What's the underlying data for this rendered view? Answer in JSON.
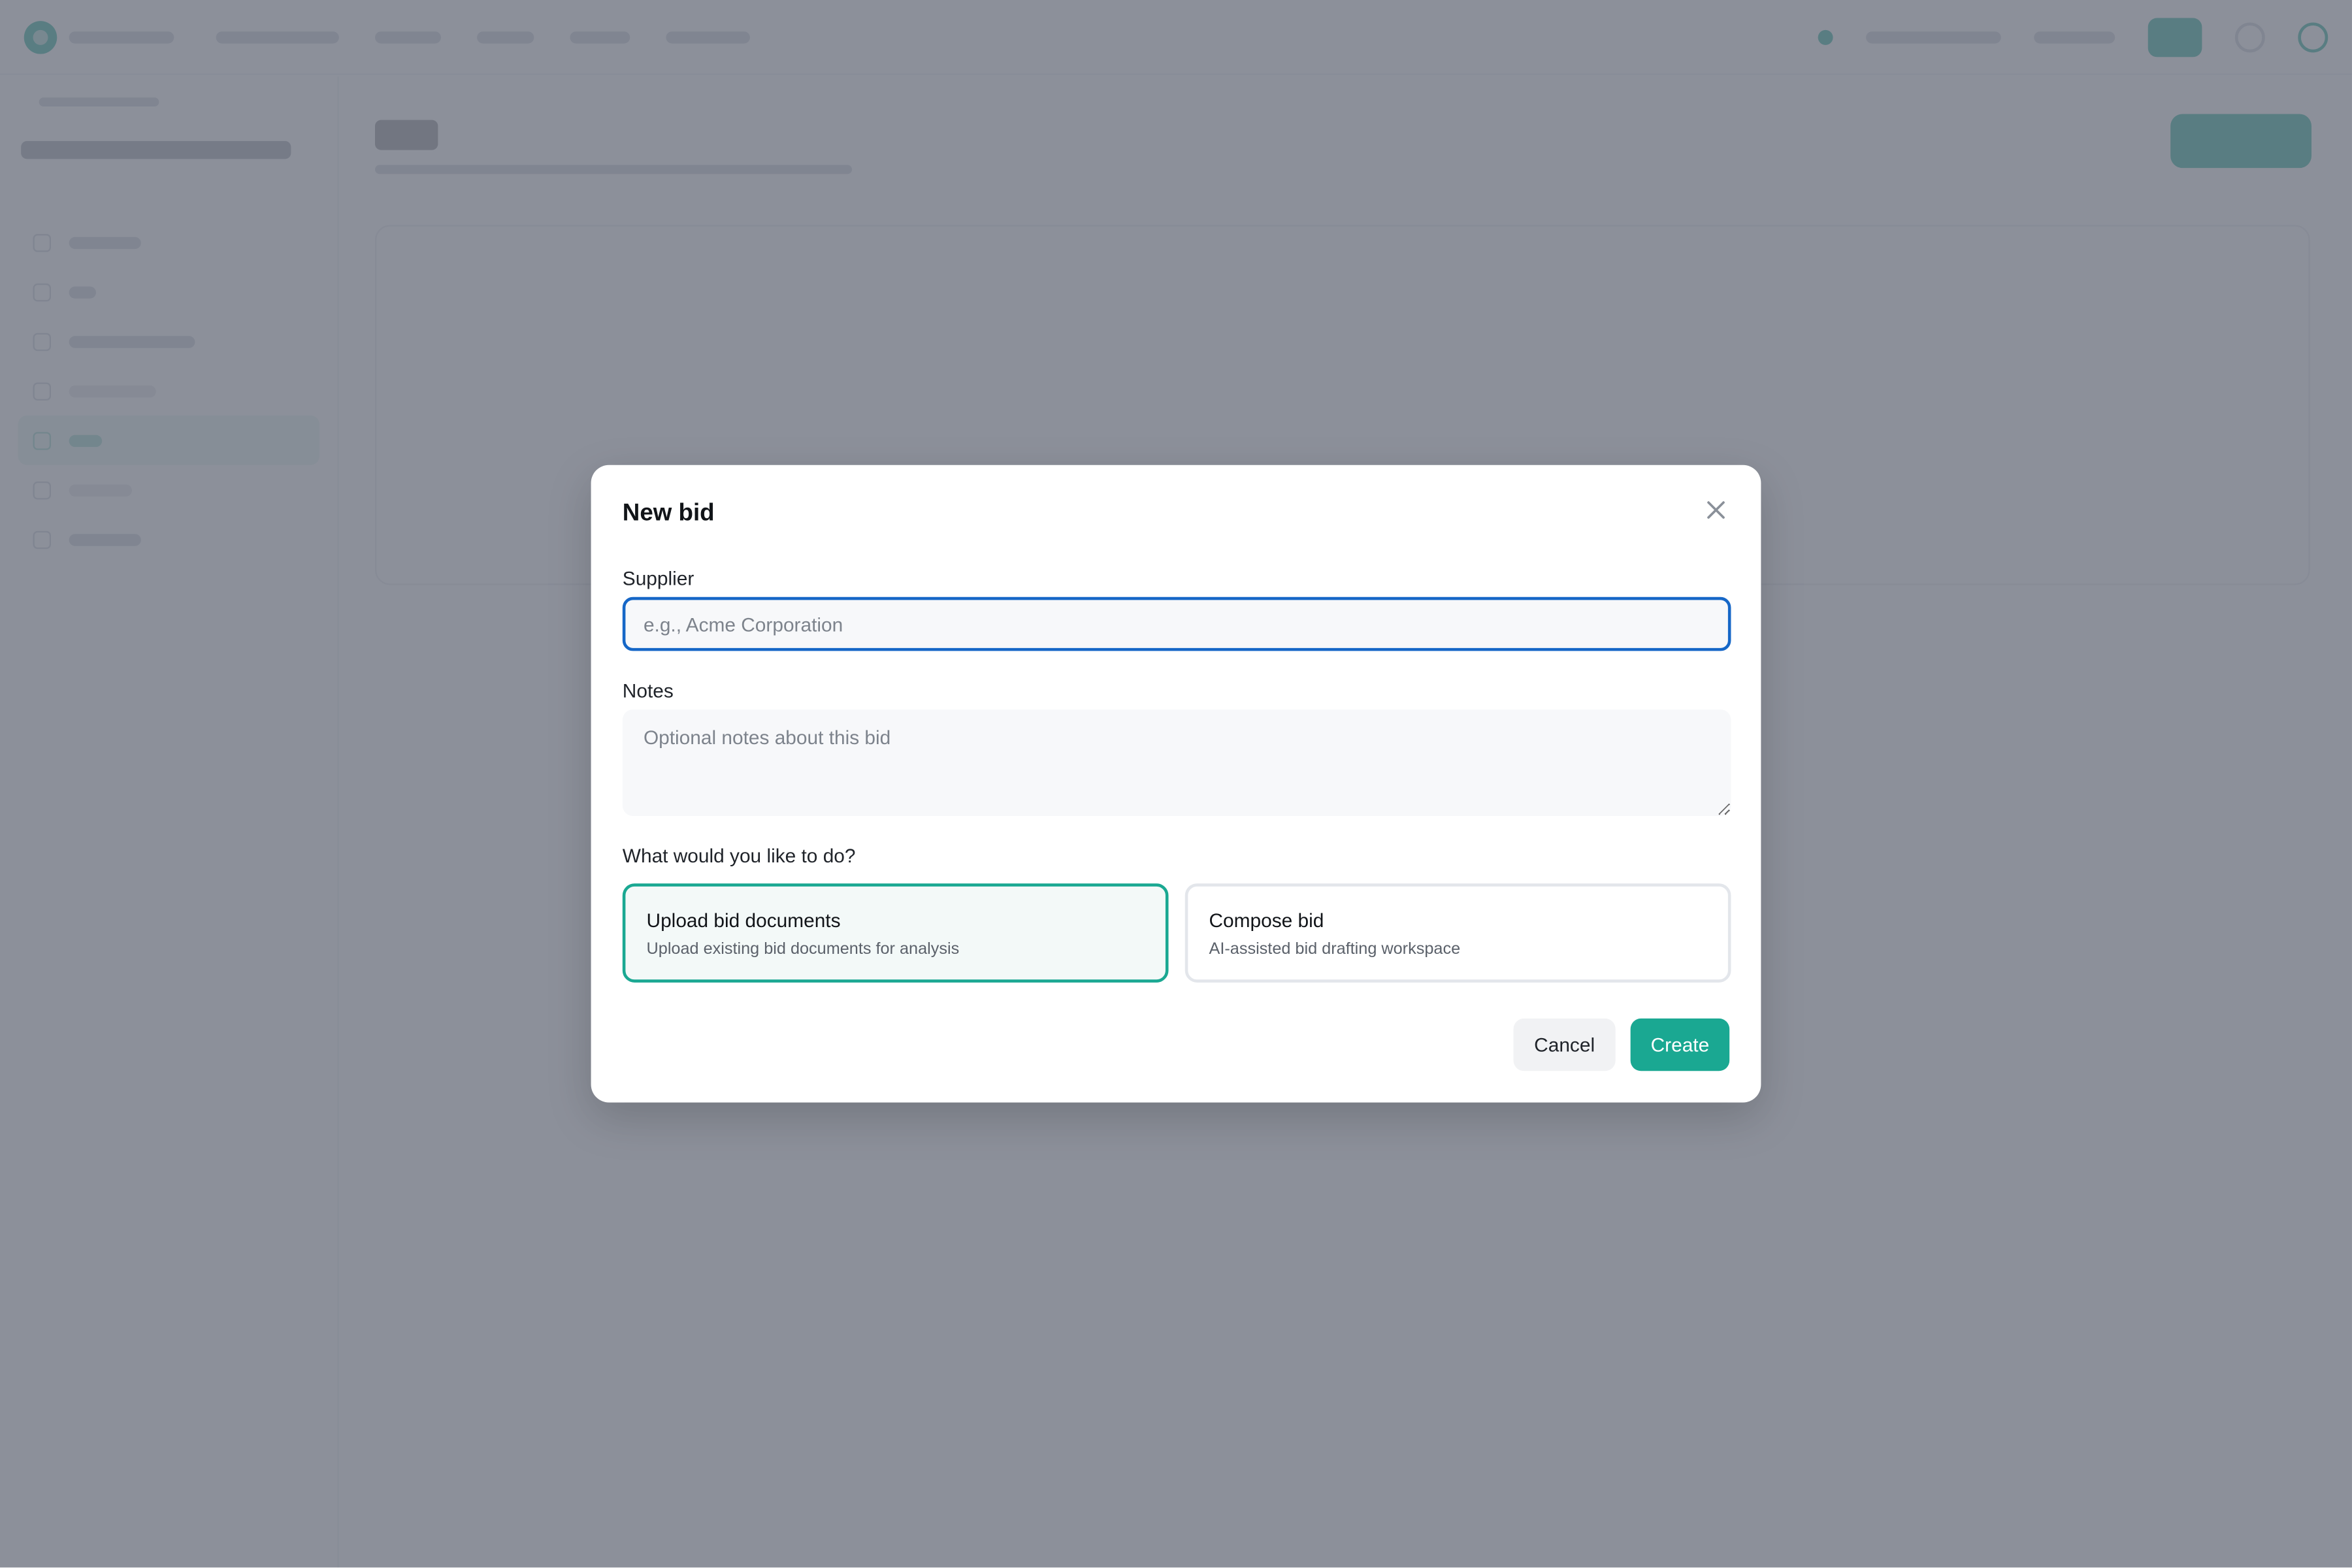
{
  "modal": {
    "title": "New bid",
    "supplier_label": "Supplier",
    "supplier_placeholder": "e.g., Acme Corporation",
    "supplier_value": "",
    "notes_label": "Notes",
    "notes_placeholder": "Optional notes about this bid",
    "notes_value": "",
    "action_question": "What would you like to do?",
    "options": [
      {
        "title": "Upload bid documents",
        "description": "Upload existing bid documents for analysis",
        "selected": true
      },
      {
        "title": "Compose bid",
        "description": "AI-assisted bid drafting workspace",
        "selected": false
      }
    ],
    "cancel_label": "Cancel",
    "create_label": "Create"
  },
  "colors": {
    "accent": "#1aa892",
    "focus_ring": "#1667c7",
    "overlay": "#6c717d"
  },
  "icons": {
    "close": "close-icon"
  }
}
